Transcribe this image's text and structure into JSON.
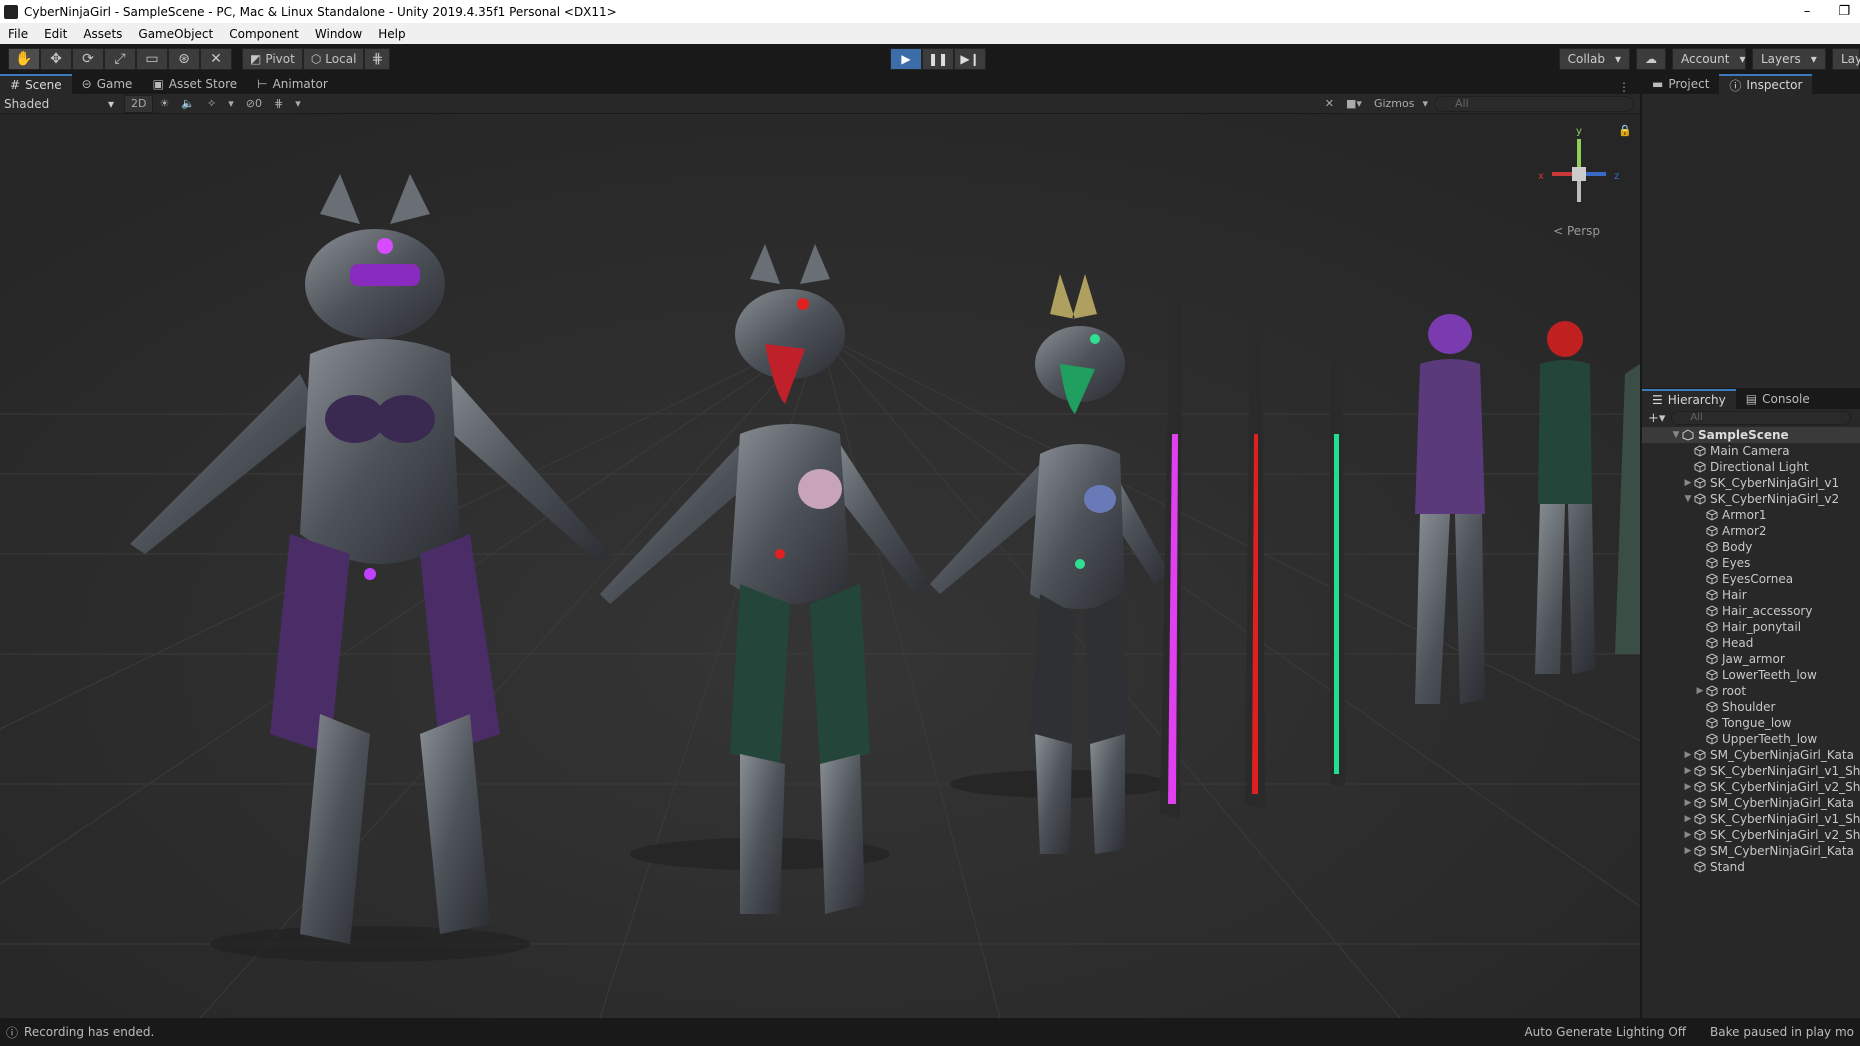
{
  "window": {
    "title": "CyberNinjaGirl - SampleScene - PC, Mac & Linux Standalone - Unity 2019.4.35f1 Personal <DX11>",
    "minimize": "–",
    "restore": "❐"
  },
  "menu": [
    "File",
    "Edit",
    "Assets",
    "GameObject",
    "Component",
    "Window",
    "Help"
  ],
  "toolbar": {
    "pivot_label": "Pivot",
    "local_label": "Local",
    "collab_label": "Collab",
    "account_label": "Account",
    "layers_label": "Layers",
    "layout_label": "Lay"
  },
  "scene_tabs": [
    "Scene",
    "Game",
    "Asset Store",
    "Animator"
  ],
  "scene_toolbar": {
    "shading_mode": "Shaded",
    "mode_2d": "2D",
    "hidden_count": "0",
    "gizmos_label": "Gizmos",
    "search_placeholder": "All"
  },
  "viewport": {
    "persp_label": "Persp",
    "gizmo_axes": {
      "y": "y",
      "x": "x",
      "z": "z"
    }
  },
  "right_tabs": [
    "Project",
    "Inspector"
  ],
  "hierarchy": {
    "tabs": [
      "Hierarchy",
      "Console"
    ],
    "search_placeholder": "All",
    "scene_name": "SampleScene",
    "items": [
      {
        "label": "Main Camera",
        "depth": 1,
        "arrow": ""
      },
      {
        "label": "Directional Light",
        "depth": 1,
        "arrow": ""
      },
      {
        "label": "SK_CyberNinjaGirl_v1",
        "depth": 1,
        "arrow": "▶"
      },
      {
        "label": "SK_CyberNinjaGirl_v2",
        "depth": 1,
        "arrow": "▼"
      },
      {
        "label": "Armor1",
        "depth": 2,
        "arrow": ""
      },
      {
        "label": "Armor2",
        "depth": 2,
        "arrow": ""
      },
      {
        "label": "Body",
        "depth": 2,
        "arrow": ""
      },
      {
        "label": "Eyes",
        "depth": 2,
        "arrow": ""
      },
      {
        "label": "EyesCornea",
        "depth": 2,
        "arrow": ""
      },
      {
        "label": "Hair",
        "depth": 2,
        "arrow": ""
      },
      {
        "label": "Hair_accessory",
        "depth": 2,
        "arrow": ""
      },
      {
        "label": "Hair_ponytail",
        "depth": 2,
        "arrow": ""
      },
      {
        "label": "Head",
        "depth": 2,
        "arrow": ""
      },
      {
        "label": "Jaw_armor",
        "depth": 2,
        "arrow": ""
      },
      {
        "label": "LowerTeeth_low",
        "depth": 2,
        "arrow": ""
      },
      {
        "label": "root",
        "depth": 2,
        "arrow": "▶"
      },
      {
        "label": "Shoulder",
        "depth": 2,
        "arrow": ""
      },
      {
        "label": "Tongue_low",
        "depth": 2,
        "arrow": ""
      },
      {
        "label": "UpperTeeth_low",
        "depth": 2,
        "arrow": ""
      },
      {
        "label": "SM_CyberNinjaGirl_Kata",
        "depth": 1,
        "arrow": "▶"
      },
      {
        "label": "SK_CyberNinjaGirl_v1_Sh",
        "depth": 1,
        "arrow": "▶"
      },
      {
        "label": "SK_CyberNinjaGirl_v2_Sh",
        "depth": 1,
        "arrow": "▶"
      },
      {
        "label": "SM_CyberNinjaGirl_Kata",
        "depth": 1,
        "arrow": "▶"
      },
      {
        "label": "SK_CyberNinjaGirl_v1_Sh",
        "depth": 1,
        "arrow": "▶"
      },
      {
        "label": "SK_CyberNinjaGirl_v2_Sh",
        "depth": 1,
        "arrow": "▶"
      },
      {
        "label": "SM_CyberNinjaGirl_Kata",
        "depth": 1,
        "arrow": "▶"
      },
      {
        "label": "Stand",
        "depth": 1,
        "arrow": ""
      }
    ]
  },
  "status": {
    "message": "Recording has ended.",
    "lighting": "Auto Generate Lighting Off",
    "bake": "Bake paused in play mo"
  },
  "colors": {
    "accent_blue": "#3d6da8",
    "figure_purple": "#a020c0",
    "figure_red": "#d02020",
    "figure_green": "#20c070"
  }
}
